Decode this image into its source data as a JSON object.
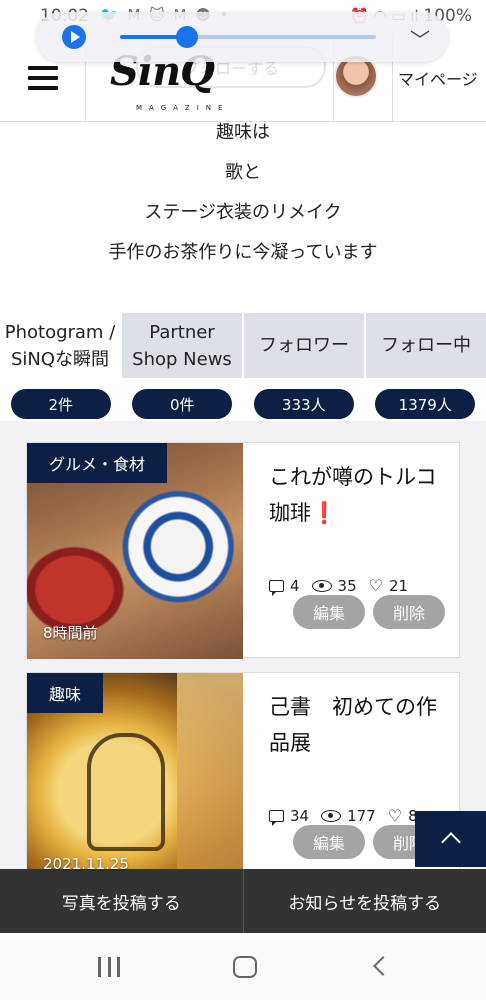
{
  "status_bar": {
    "time": "10:02",
    "notification_glyphs": "🐦 M 🐱 M ☻ •",
    "system_glyphs": "⏰ ◠ ▭ ıl",
    "battery": "100%"
  },
  "media_player": {
    "progress": 0.26,
    "play_icon": "play-icon",
    "collapse_icon": "chevron-down-icon"
  },
  "header": {
    "logo_text": "SinQ",
    "logo_subtext": "MAGAZINE",
    "ghost_follow": "フォローする",
    "mypage_label": "マイページ"
  },
  "bio": {
    "lines": [
      "趣味は",
      "歌と",
      "ステージ衣装のリメイク",
      "手作のお茶作りに今凝っています"
    ]
  },
  "tabs": [
    {
      "line1": "Photogram /",
      "line2": "SiNQな瞬間"
    },
    {
      "line1": "Partner",
      "line2": "Shop News"
    },
    {
      "line1": "フォロワー",
      "line2": ""
    },
    {
      "line1": "フォロー中",
      "line2": ""
    }
  ],
  "counts": [
    "2件",
    "0件",
    "333人",
    "1379人"
  ],
  "posts": [
    {
      "category": "グルメ・食材",
      "time": "8時間前",
      "title": "これが噂のトルコ珈琲❗",
      "comments": "4",
      "views": "35",
      "likes": "21",
      "edit_label": "編集",
      "delete_label": "削除"
    },
    {
      "category": "趣味",
      "time": "2021.11.25",
      "title": "己書　初めての作品展",
      "comments": "34",
      "views": "177",
      "likes": "8",
      "edit_label": "編集",
      "delete_label": "削除"
    }
  ],
  "bottom_actions": {
    "post_photo": "写真を投稿する",
    "post_news": "お知らせを投稿する"
  },
  "colors": {
    "navy": "#0d1f44",
    "tab_bg": "#dde0e6",
    "button_gray": "#a4a4a4",
    "bottom_bar": "#333333",
    "player_blue": "#1a73e8"
  }
}
